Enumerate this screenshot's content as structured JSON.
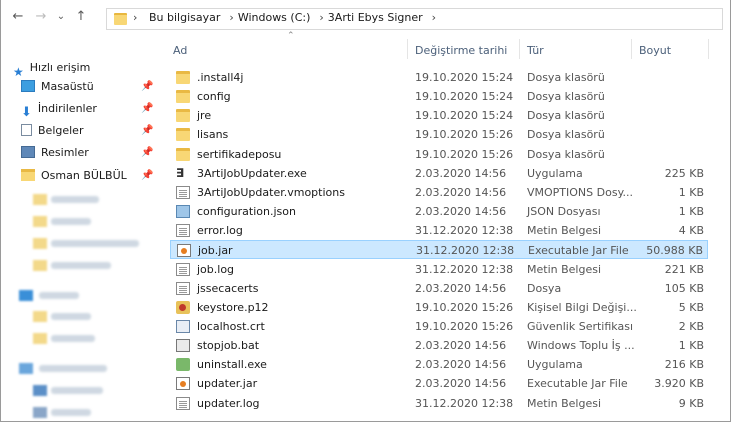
{
  "address": {
    "crumbs": [
      "Bu bilgisayar",
      "Windows (C:)",
      "3Arti Ebys Signer"
    ]
  },
  "sidebar": {
    "quick_access": "Hızlı erişim",
    "items": [
      {
        "label": "Masaüstü",
        "icon": "desktop-icon"
      },
      {
        "label": "İndirilenler",
        "icon": "download-icon"
      },
      {
        "label": "Belgeler",
        "icon": "documents-icon"
      },
      {
        "label": "Resimler",
        "icon": "pictures-icon"
      },
      {
        "label": "Osman BÜLBÜL",
        "icon": "folder-icon"
      }
    ]
  },
  "columns": {
    "name": "Ad",
    "date": "Değiştirme tarihi",
    "type": "Tür",
    "size": "Boyut"
  },
  "files": [
    {
      "name": ".install4j",
      "date": "19.10.2020 15:24",
      "type": "Dosya klasörü",
      "size": "",
      "icon": "folder"
    },
    {
      "name": "config",
      "date": "19.10.2020 15:24",
      "type": "Dosya klasörü",
      "size": "",
      "icon": "folder"
    },
    {
      "name": "jre",
      "date": "19.10.2020 15:24",
      "type": "Dosya klasörü",
      "size": "",
      "icon": "folder"
    },
    {
      "name": "lisans",
      "date": "19.10.2020 15:26",
      "type": "Dosya klasörü",
      "size": "",
      "icon": "folder"
    },
    {
      "name": "sertifikadeposu",
      "date": "19.10.2020 15:26",
      "type": "Dosya klasörü",
      "size": "",
      "icon": "folder"
    },
    {
      "name": "3ArtiJobUpdater.exe",
      "date": "2.03.2020 14:56",
      "type": "Uygulama",
      "size": "225 KB",
      "icon": "exe"
    },
    {
      "name": "3ArtiJobUpdater.vmoptions",
      "date": "2.03.2020 14:56",
      "type": "VMOPTIONS Dosy...",
      "size": "1 KB",
      "icon": "doc"
    },
    {
      "name": "configuration.json",
      "date": "2.03.2020 14:56",
      "type": "JSON Dosyası",
      "size": "1 KB",
      "icon": "cfg"
    },
    {
      "name": "error.log",
      "date": "31.12.2020 12:38",
      "type": "Metin Belgesi",
      "size": "4 KB",
      "icon": "doc"
    },
    {
      "name": "job.jar",
      "date": "31.12.2020 12:38",
      "type": "Executable Jar File",
      "size": "50.988 KB",
      "icon": "jar",
      "selected": true
    },
    {
      "name": "job.log",
      "date": "31.12.2020 12:38",
      "type": "Metin Belgesi",
      "size": "221 KB",
      "icon": "doc"
    },
    {
      "name": "jssecacerts",
      "date": "2.03.2020 14:56",
      "type": "Dosya",
      "size": "105 KB",
      "icon": "doc"
    },
    {
      "name": "keystore.p12",
      "date": "19.10.2020 15:26",
      "type": "Kişisel Bilgi Değişi...",
      "size": "5 KB",
      "icon": "key"
    },
    {
      "name": "localhost.crt",
      "date": "19.10.2020 15:26",
      "type": "Güvenlik Sertifikası",
      "size": "2 KB",
      "icon": "crt"
    },
    {
      "name": "stopjob.bat",
      "date": "2.03.2020 14:56",
      "type": "Windows Toplu İş ...",
      "size": "1 KB",
      "icon": "bat"
    },
    {
      "name": "uninstall.exe",
      "date": "2.03.2020 14:56",
      "type": "Uygulama",
      "size": "216 KB",
      "icon": "unins"
    },
    {
      "name": "updater.jar",
      "date": "2.03.2020 14:56",
      "type": "Executable Jar File",
      "size": "3.920 KB",
      "icon": "jar"
    },
    {
      "name": "updater.log",
      "date": "31.12.2020 12:38",
      "type": "Metin Belgesi",
      "size": "9 KB",
      "icon": "doc"
    }
  ]
}
